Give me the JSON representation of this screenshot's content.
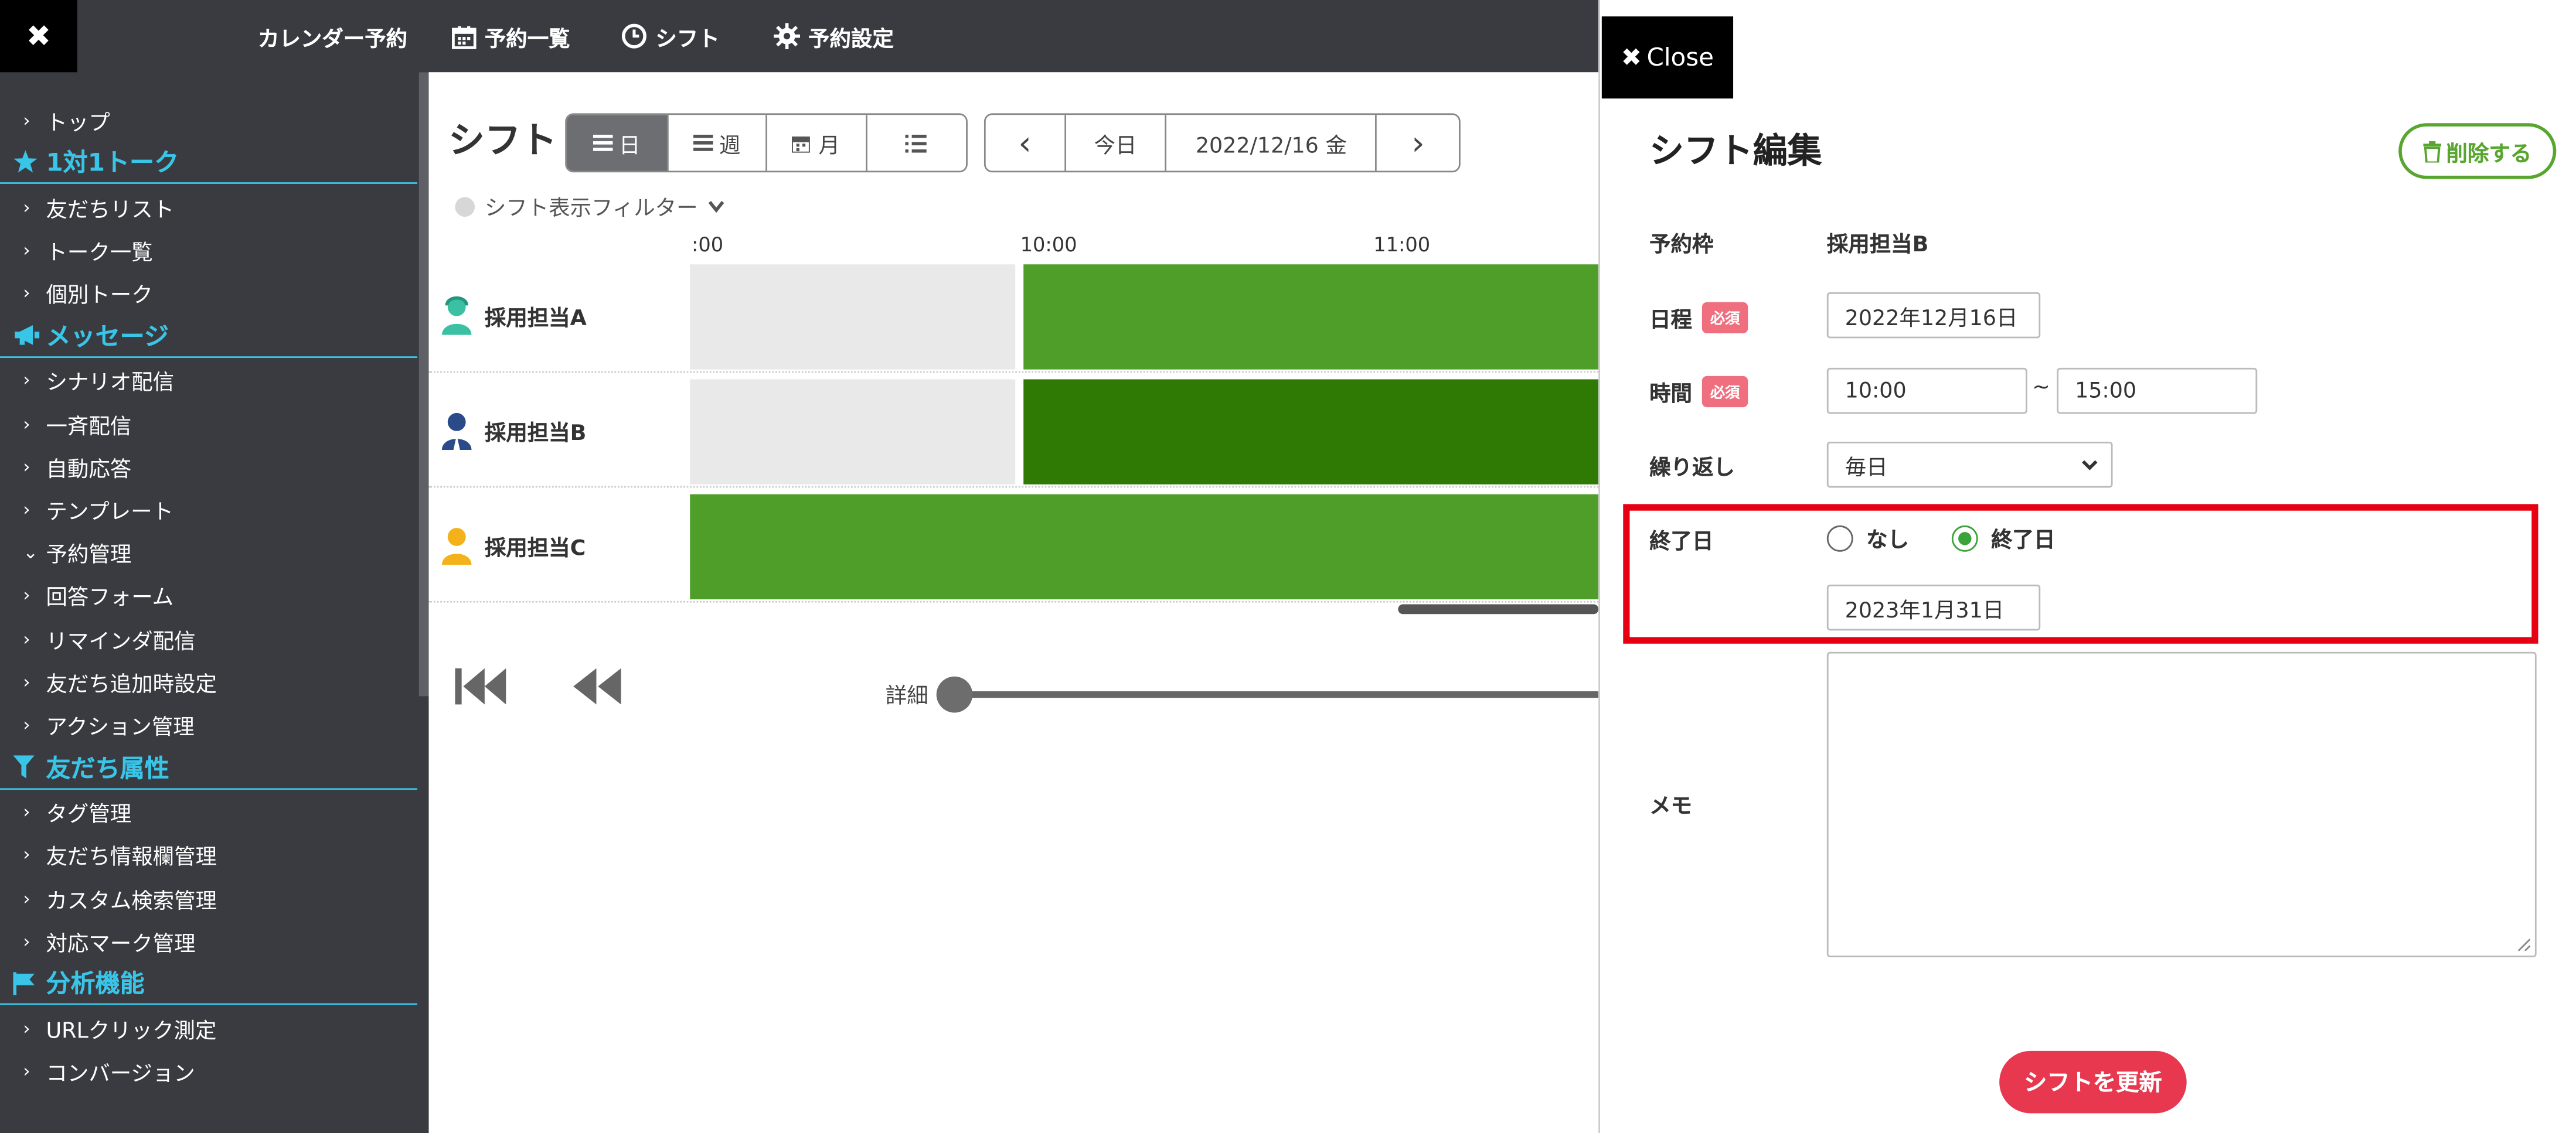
{
  "sidebar": {
    "close_glyph": "✖",
    "items": [
      {
        "type": "item",
        "label": "トップ",
        "chev": "›"
      },
      {
        "type": "section",
        "label": "1対1トーク",
        "icon": "star-icon"
      },
      {
        "type": "item",
        "label": "友だちリスト",
        "chev": "›"
      },
      {
        "type": "item",
        "label": "トーク一覧",
        "chev": "›"
      },
      {
        "type": "item",
        "label": "個別トーク",
        "chev": "›"
      },
      {
        "type": "section",
        "label": "メッセージ",
        "icon": "megaphone-icon"
      },
      {
        "type": "item",
        "label": "シナリオ配信",
        "chev": "›"
      },
      {
        "type": "item",
        "label": "一斉配信",
        "chev": "›"
      },
      {
        "type": "item",
        "label": "自動応答",
        "chev": "›"
      },
      {
        "type": "item",
        "label": "テンプレート",
        "chev": "›"
      },
      {
        "type": "item",
        "label": "予約管理",
        "chev": "⌄"
      },
      {
        "type": "item",
        "label": "回答フォーム",
        "chev": "›"
      },
      {
        "type": "item",
        "label": "リマインダ配信",
        "chev": "›"
      },
      {
        "type": "item",
        "label": "友だち追加時設定",
        "chev": "›"
      },
      {
        "type": "item",
        "label": "アクション管理",
        "chev": "›"
      },
      {
        "type": "section",
        "label": "友だち属性",
        "icon": "filter-icon"
      },
      {
        "type": "item",
        "label": "タグ管理",
        "chev": "›"
      },
      {
        "type": "item",
        "label": "友だち情報欄管理",
        "chev": "›"
      },
      {
        "type": "item",
        "label": "カスタム検索管理",
        "chev": "›"
      },
      {
        "type": "item",
        "label": "対応マーク管理",
        "chev": "›"
      },
      {
        "type": "section",
        "label": "分析機能",
        "icon": "flag-icon"
      },
      {
        "type": "item",
        "label": "URLクリック測定",
        "chev": "›"
      },
      {
        "type": "item",
        "label": "コンバージョン",
        "chev": "›"
      }
    ]
  },
  "topbar": {
    "nav": [
      {
        "label": "カレンダー予約",
        "icon": ""
      },
      {
        "label": "予約一覧",
        "icon": "calendar-icon"
      },
      {
        "label": "シフト",
        "icon": "clock-icon"
      },
      {
        "label": "予約設定",
        "icon": "gear-icon"
      }
    ]
  },
  "main": {
    "title": "シフト",
    "view_buttons": [
      {
        "label": "日",
        "icon": "list-icon",
        "active": true
      },
      {
        "label": "週",
        "icon": "list-icon",
        "active": false
      },
      {
        "label": "月",
        "icon": "calendar-icon",
        "active": false
      },
      {
        "label": "",
        "icon": "bullet-list-icon",
        "active": false
      }
    ],
    "date_nav": {
      "prev": "‹",
      "today": "今日",
      "date": "2022/12/16 金",
      "next": "›"
    },
    "filter_label": "シフト表示フィルター",
    "ticks": [
      ":00",
      "10:00",
      "11:00"
    ],
    "rows": [
      {
        "name": "採用担当A",
        "avatar_color": "#3cc0a3",
        "bar_color": "#509e2a"
      },
      {
        "name": "採用担当B",
        "avatar_color": "#2b4a8a",
        "bar_color": "#2f7a05"
      },
      {
        "name": "採用担当C",
        "avatar_color": "#f3b21a",
        "bar_color": "#509e2a"
      }
    ],
    "detail_label": "詳細"
  },
  "panel": {
    "close_label": "Close",
    "title": "シフト編集",
    "delete_label": "削除する",
    "fields": {
      "slot_label": "予約枠",
      "slot_value": "採用担当B",
      "date_label": "日程",
      "required": "必須",
      "date_value": "2022年12月16日",
      "time_label": "時間",
      "time_start": "10:00",
      "time_sep": "~",
      "time_end": "15:00",
      "repeat_label": "繰り返し",
      "repeat_value": "毎日",
      "end_label": "終了日",
      "opt_none": "なし",
      "opt_end": "終了日",
      "end_value": "2023年1月31日",
      "memo_label": "メモ"
    },
    "submit_label": "シフトを更新"
  },
  "colors": {
    "accent": "#39c5e8",
    "highlight": "#e60012",
    "submit": "#e8384f",
    "delete": "#58a630"
  }
}
